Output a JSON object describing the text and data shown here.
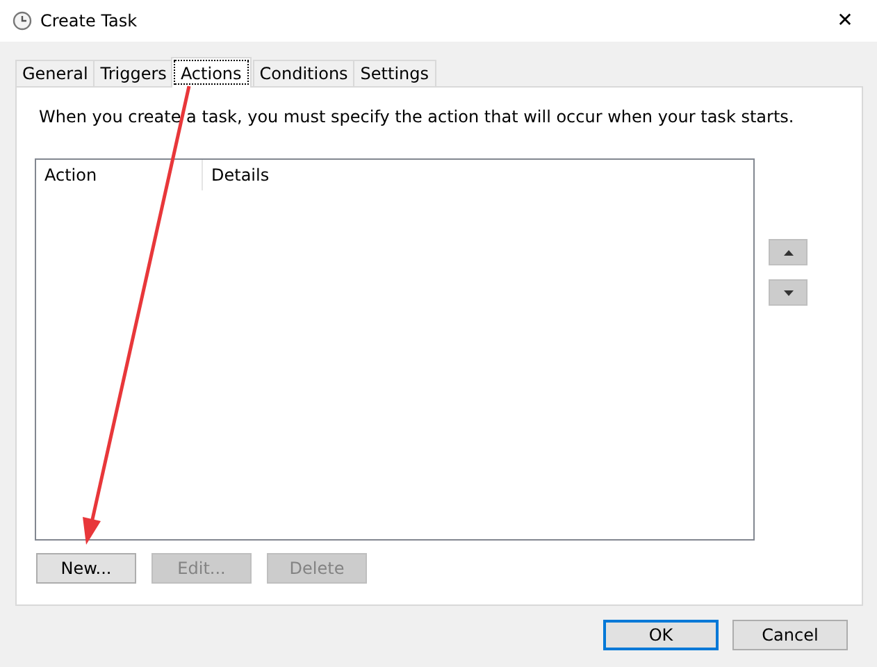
{
  "window": {
    "title": "Create Task",
    "close": "✕"
  },
  "tabs": [
    {
      "label": "General",
      "selected": false
    },
    {
      "label": "Triggers",
      "selected": false
    },
    {
      "label": "Actions",
      "selected": true
    },
    {
      "label": "Conditions",
      "selected": false
    },
    {
      "label": "Settings",
      "selected": false
    }
  ],
  "description": "When you create a task, you must specify the action that will occur when your task starts.",
  "table": {
    "columns": [
      "Action",
      "Details"
    ]
  },
  "action_buttons": [
    {
      "label": "New...",
      "disabled": false
    },
    {
      "label": "Edit...",
      "disabled": true
    },
    {
      "label": "Delete",
      "disabled": true
    }
  ],
  "dialog_buttons": [
    {
      "label": "OK",
      "default": true
    },
    {
      "label": "Cancel",
      "default": false
    }
  ]
}
